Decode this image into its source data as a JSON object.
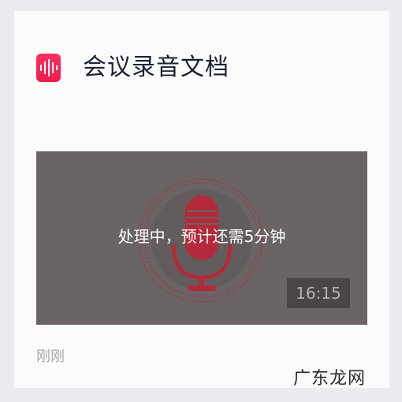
{
  "app": {
    "title": "会议录音文档",
    "icon": "audio-waveform-icon",
    "accent_color": "#f5265a"
  },
  "recording": {
    "status_text": "处理中，预计还需5分钟",
    "duration": "16:15",
    "cover_icon": "microphone-icon",
    "timestamp": "刚刚"
  },
  "watermark": {
    "text": "广东龙网"
  }
}
